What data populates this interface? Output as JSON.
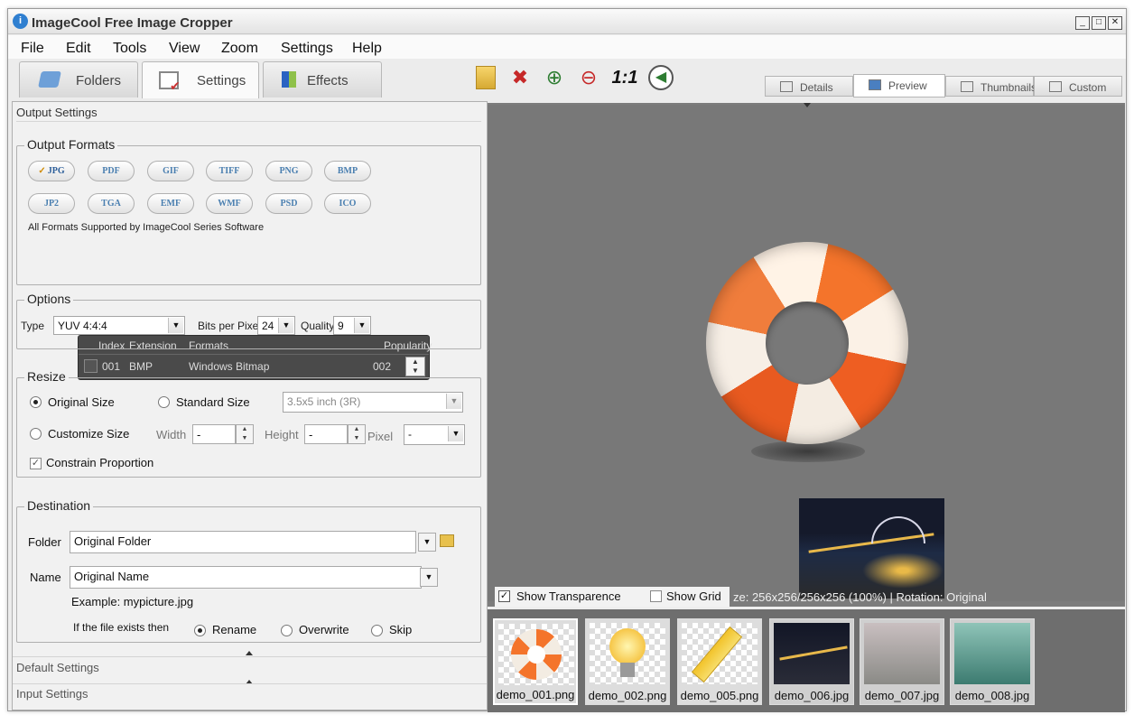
{
  "window": {
    "title": "ImageCool Free Image Cropper"
  },
  "menu": [
    "File",
    "Edit",
    "Tools",
    "View",
    "Zoom",
    "Settings",
    "Help"
  ],
  "tabs": [
    {
      "label": "Folders",
      "icon": "folder-icon"
    },
    {
      "label": "Settings",
      "icon": "settings-icon"
    },
    {
      "label": "Effects",
      "icon": "effects-icon"
    }
  ],
  "toolbar": {
    "zoom_actual_label": "1:1"
  },
  "view_tabs": [
    "Details",
    "Preview",
    "Thumbnails",
    "Custom"
  ],
  "output_settings": {
    "header": "Output Settings",
    "formats_legend": "Output Formats",
    "formats_row1": [
      "JPG",
      "PDF",
      "GIF",
      "TIFF",
      "PNG",
      "BMP"
    ],
    "formats_row2": [
      "JP2",
      "TGA",
      "EMF",
      "WMF",
      "PSD",
      "ICO"
    ],
    "checked_format": "JPG",
    "formats_note": "All Formats Supported by ImageCool Series Software",
    "grid": {
      "headers": [
        "Index",
        "Extension",
        "Formats",
        "Popularity"
      ],
      "row": {
        "index": "001",
        "extension": "BMP",
        "format": "Windows Bitmap",
        "popularity": "002"
      }
    },
    "options_legend": "Options",
    "type_label": "Type",
    "type_value": "YUV 4:4:4",
    "bpp_label": "Bits per Pixel",
    "bpp_value": "24",
    "quality_label": "Quality",
    "quality_value": "9",
    "resize_legend": "Resize",
    "original_size": "Original Size",
    "standard_size": "Standard Size",
    "standard_value": "3.5x5 inch (3R)",
    "customize_size": "Customize Size",
    "width_label": "Width",
    "width_value": "-",
    "height_label": "Height",
    "height_value": "-",
    "pixel_label": "Pixel",
    "pixel_value": "-",
    "constrain": "Constrain Proportion",
    "destination_legend": "Destination",
    "folder_label": "Folder",
    "folder_value": "Original Folder",
    "name_label": "Name",
    "name_value": "Original Name",
    "example": "Example: mypicture.jpg",
    "exists_label": "If the file exists then",
    "rename": "Rename",
    "overwrite": "Overwrite",
    "skip": "Skip"
  },
  "sections": {
    "default": "Default Settings",
    "input": "Input Settings"
  },
  "preview": {
    "show_transparence": "Show Transparence",
    "show_grid": "Show Grid",
    "info": "ze: 256x256/256x256 (100%)  |  Rotation: Original"
  },
  "thumbnails": [
    "demo_001.png",
    "demo_002.png",
    "demo_005.png",
    "demo_006.jpg",
    "demo_007.jpg",
    "demo_008.jpg"
  ]
}
